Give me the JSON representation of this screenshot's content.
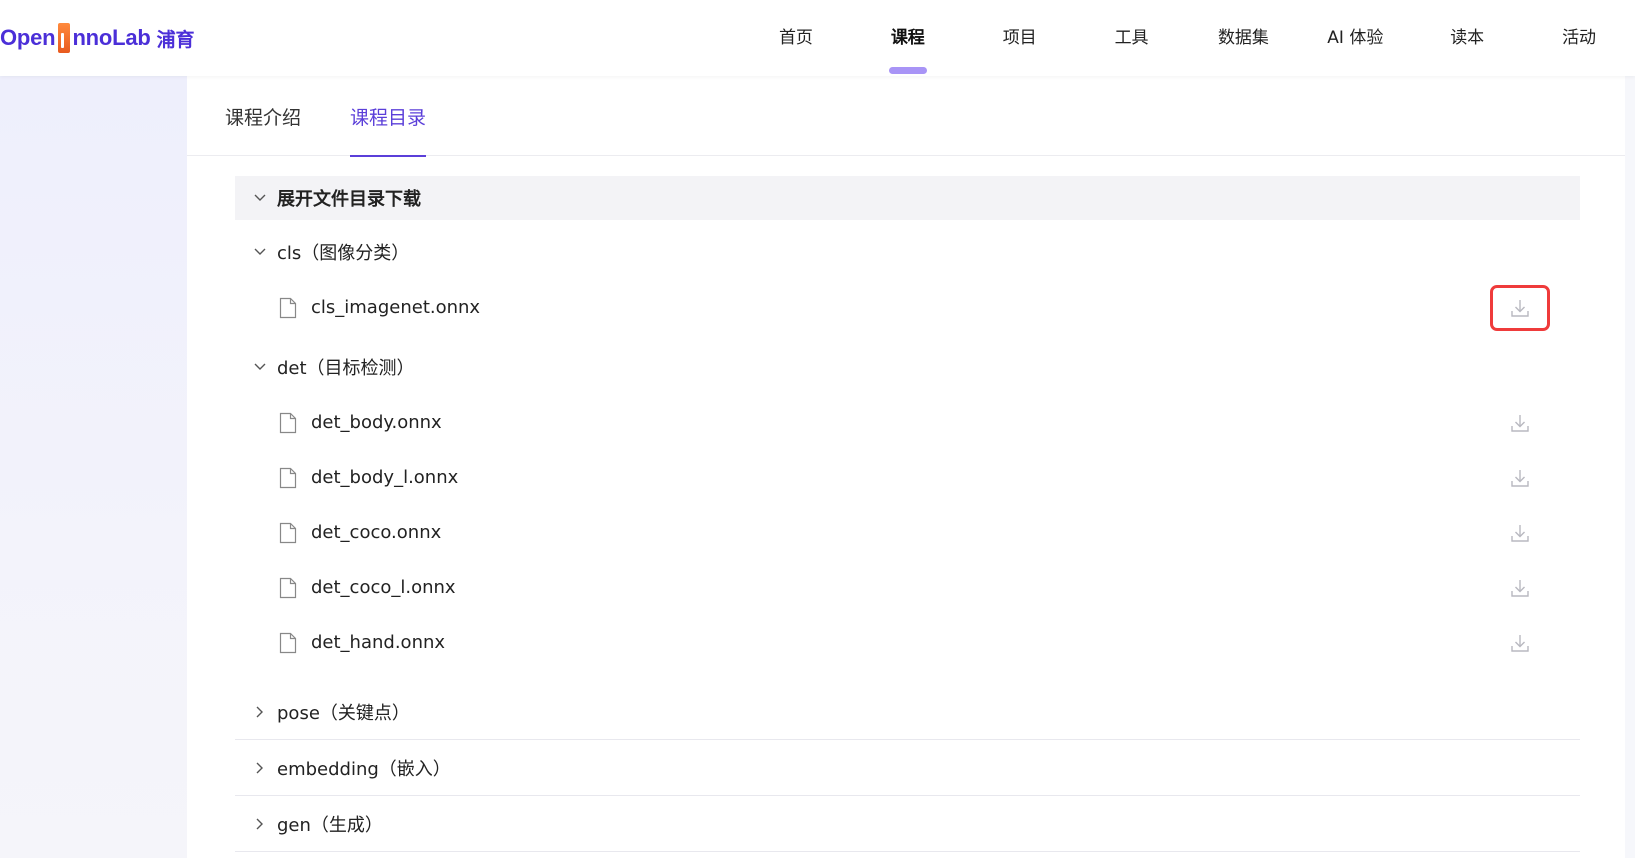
{
  "header": {
    "logo_text_1": "Open",
    "logo_text_2": "nnoLab",
    "logo_cn": "浦育",
    "nav": [
      {
        "label": "首页"
      },
      {
        "label": "课程",
        "active": true
      },
      {
        "label": "项目"
      },
      {
        "label": "工具"
      },
      {
        "label": "数据集"
      },
      {
        "label": "AI 体验"
      },
      {
        "label": "读本"
      },
      {
        "label": "活动"
      }
    ]
  },
  "tabs": [
    {
      "label": "课程介绍"
    },
    {
      "label": "课程目录",
      "active": true
    }
  ],
  "catalog": {
    "section_title": "展开文件目录下载",
    "groups": [
      {
        "name": "cls（图像分类）",
        "expanded": true,
        "files": [
          {
            "name": "cls_imagenet.onnx",
            "highlighted": true
          }
        ]
      },
      {
        "name": "det（目标检测）",
        "expanded": true,
        "files": [
          {
            "name": "det_body.onnx"
          },
          {
            "name": "det_body_l.onnx"
          },
          {
            "name": "det_coco.onnx"
          },
          {
            "name": "det_coco_l.onnx"
          },
          {
            "name": "det_hand.onnx"
          }
        ]
      },
      {
        "name": "pose（关键点）",
        "expanded": false
      },
      {
        "name": "embedding（嵌入）",
        "expanded": false
      },
      {
        "name": "gen（生成）",
        "expanded": false
      }
    ]
  },
  "icons": {
    "chevron_down": "chevron-down-icon",
    "chevron_right": "chevron-right-icon",
    "file": "file-icon",
    "download": "download-icon"
  },
  "colors": {
    "brand": "#4b2fd8",
    "active_tab": "#5b3fd9",
    "nav_indicator": "#a894f6",
    "highlight_box": "#ef3b3b",
    "download_icon": "#b8b8c0"
  }
}
